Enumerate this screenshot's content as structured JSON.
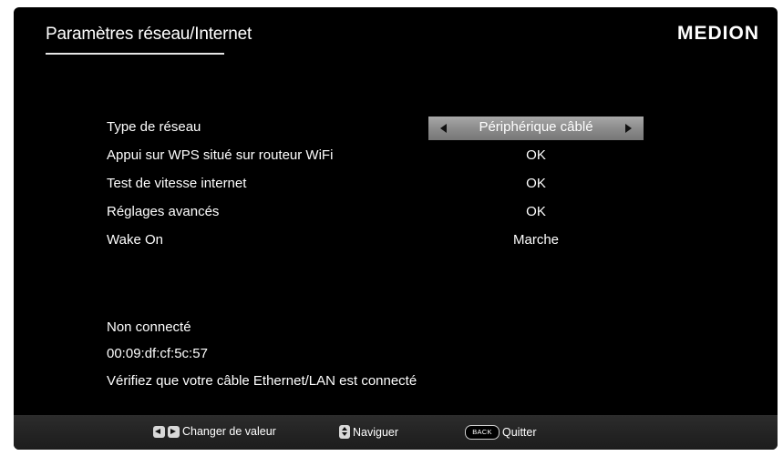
{
  "header": {
    "title": "Paramètres réseau/Internet",
    "brand": "MEDION"
  },
  "settings": [
    {
      "label": "Type de réseau",
      "value": "Périphérique câblé",
      "selected": true
    },
    {
      "label": "Appui sur WPS situé sur routeur WiFi",
      "value": "OK"
    },
    {
      "label": "Test de vitesse internet",
      "value": "OK"
    },
    {
      "label": "Réglages avancés",
      "value": "OK"
    },
    {
      "label": "Wake On",
      "value": "Marche"
    }
  ],
  "status": {
    "connection": "Non connecté",
    "mac_address": "00:09:df:cf:5c:57",
    "message": "Vérifiez que votre câble Ethernet/LAN est connecté"
  },
  "footer": {
    "change_value": "Changer de valeur",
    "navigate": "Naviguer",
    "back_key": "BACK",
    "quit": "Quitter"
  },
  "icons": [
    "left-right-arrow-keys-icon",
    "up-down-arrow-key-icon",
    "back-key-icon",
    "left-arrow-icon",
    "right-arrow-icon"
  ],
  "colors": {
    "background": "#000000",
    "selection": "#9a9a9a",
    "footer": "#242424",
    "text": "#ffffff"
  }
}
